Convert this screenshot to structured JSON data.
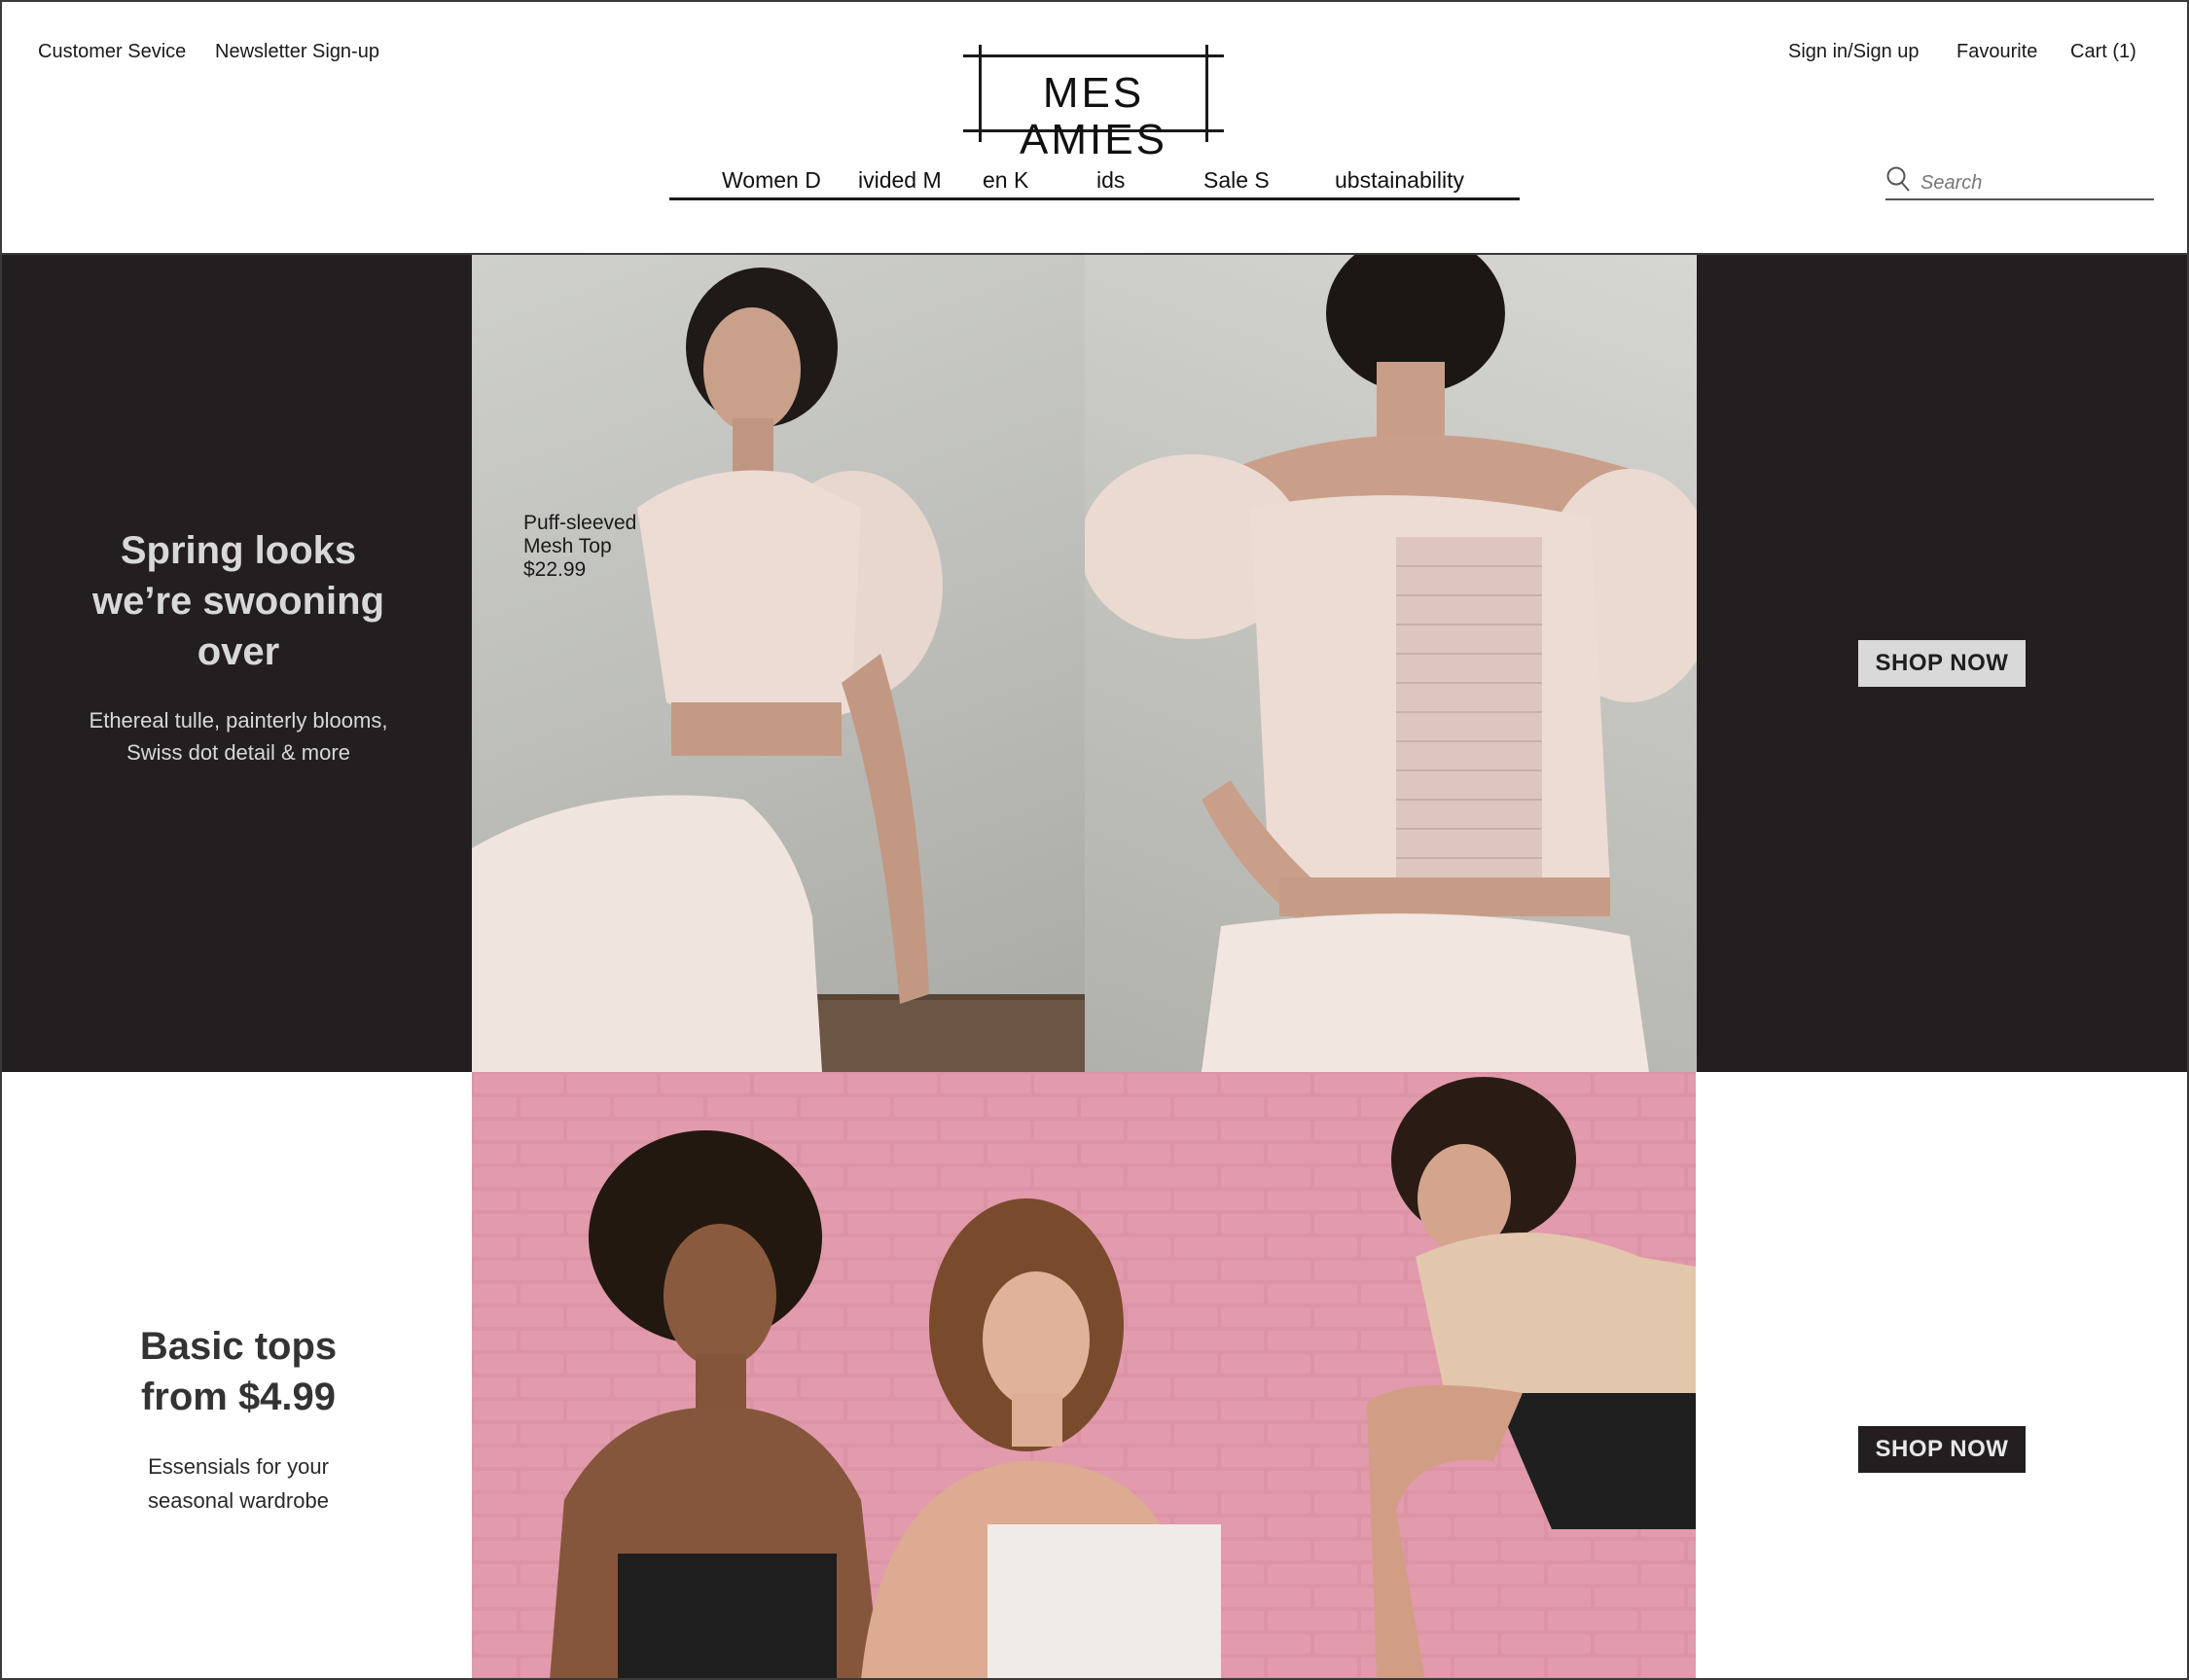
{
  "header": {
    "left_links": [
      "Customer Sevice",
      "Newsletter Sign-up"
    ],
    "right_links": [
      "Sign in/Sign up",
      "Favourite",
      "Cart (1)"
    ],
    "logo": "MES AMIES",
    "nav": [
      "Women D",
      "ivided M",
      "en K",
      "ids",
      "Sale S",
      "ubstainability"
    ],
    "search_placeholder": "Search"
  },
  "hero1": {
    "headline_lines": [
      "Spring looks",
      "we’re swooning",
      "over"
    ],
    "subtext_lines": [
      "Ethereal tulle, painterly blooms,",
      "Swiss dot detail & more"
    ],
    "product": {
      "name_lines": [
        "Puff-sleeved",
        "Mesh Top"
      ],
      "price": "$22.99"
    },
    "cta": "SHOP NOW",
    "images": [
      "model-front-mesh-top-photo",
      "model-back-mesh-top-photo"
    ]
  },
  "hero2": {
    "headline_lines": [
      "Basic tops",
      "from $4.99"
    ],
    "subtext_lines": [
      "Essensials for your",
      "seasonal wardrobe"
    ],
    "cta": "SHOP NOW",
    "images": [
      "three-models-pink-brick-wall-photo"
    ]
  },
  "colors": {
    "dark_panel": "#231f20",
    "light_button": "#d9d9d9",
    "dark_button": "#231f20",
    "pink_wall": "#d98fa3"
  },
  "icons": [
    "search-icon"
  ]
}
